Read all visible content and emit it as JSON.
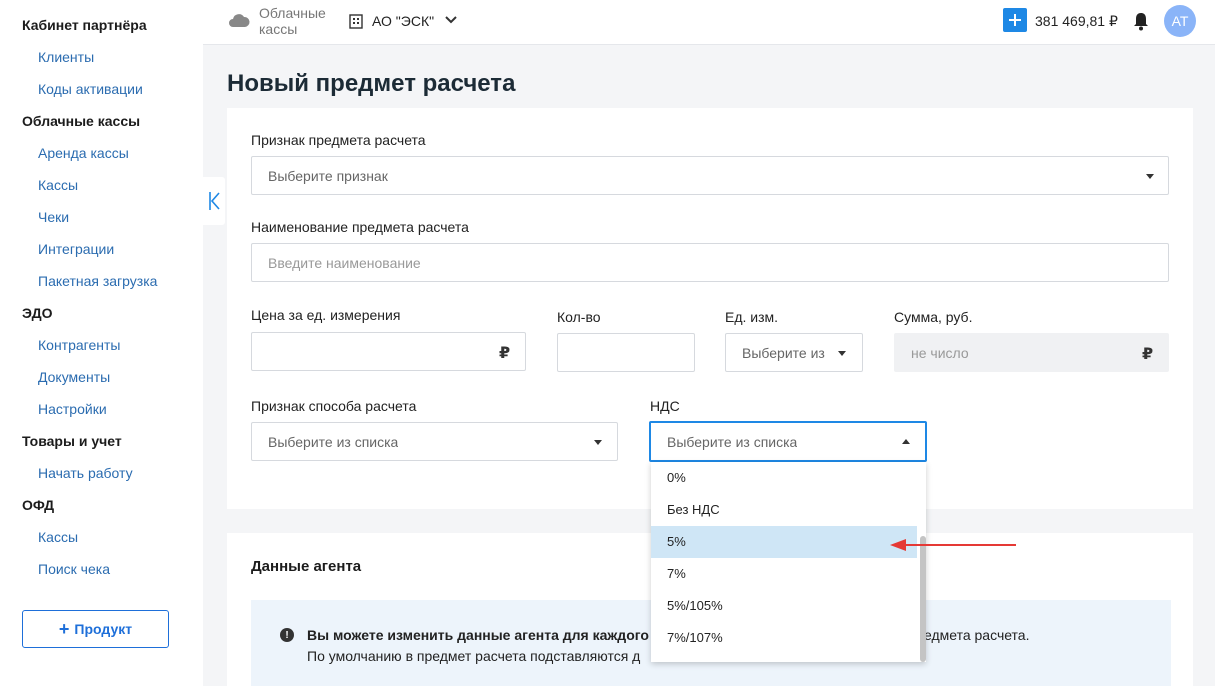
{
  "sidebar": {
    "sections": [
      {
        "title": "Кабинет партнёра",
        "items": [
          "Клиенты",
          "Коды активации"
        ]
      },
      {
        "title": "Облачные кассы",
        "items": [
          "Аренда кассы",
          "Кассы",
          "Чеки",
          "Интеграции",
          "Пакетная загрузка"
        ]
      },
      {
        "title": "ЭДО",
        "items": [
          "Контрагенты",
          "Документы",
          "Настройки"
        ]
      },
      {
        "title": "Товары и учет",
        "items": [
          "Начать работу"
        ]
      },
      {
        "title": "ОФД",
        "items": [
          "Кассы",
          "Поиск чека"
        ]
      }
    ],
    "product_button": "Продукт"
  },
  "topbar": {
    "brand_line1": "Облачные",
    "brand_line2": "кассы",
    "org_name": "АО \"ЭСК\"",
    "balance": "381 469,81 ₽",
    "avatar": "АТ"
  },
  "page": {
    "title": "Новый предмет расчета"
  },
  "form": {
    "sign_label": "Признак предмета расчета",
    "sign_placeholder": "Выберите признак",
    "name_label": "Наименование предмета расчета",
    "name_placeholder": "Введите наименование",
    "price_label": "Цена за ед. измерения",
    "qty_label": "Кол-во",
    "unit_label": "Ед. изм.",
    "unit_placeholder": "Выберите из",
    "sum_label": "Сумма, руб.",
    "sum_placeholder": "не число",
    "currency": "₽",
    "method_label": "Признак способа расчета",
    "method_placeholder": "Выберите из списка",
    "vat_label": "НДС",
    "vat_placeholder": "Выберите из списка"
  },
  "vat_options": [
    "0%",
    "Без НДС",
    "5%",
    "7%",
    "5%/105%",
    "7%/107%"
  ],
  "vat_highlighted": "5%",
  "agent": {
    "title": "Данные агента",
    "info_line1": "Вы можете изменить данные агента для каждого п",
    "info_line1_tail": "едмета расчета.",
    "info_line2": "По умолчанию в предмет расчета подставляются д"
  },
  "colors": {
    "accent": "#1e88e5",
    "link": "#2b6cb0",
    "highlight": "#cfe6f6",
    "arrow": "#e53935"
  }
}
